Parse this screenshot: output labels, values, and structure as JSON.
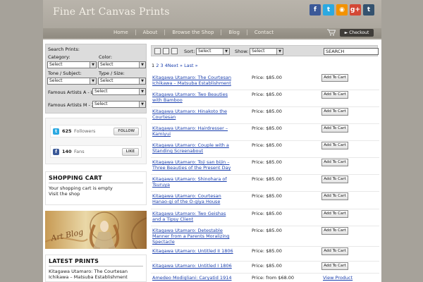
{
  "site": {
    "title": "Fine Art Canvas Prints"
  },
  "social": [
    {
      "name": "facebook-icon",
      "glyph": "f",
      "color": "#3b5998"
    },
    {
      "name": "twitter-icon",
      "glyph": "t",
      "color": "#2ba9e1"
    },
    {
      "name": "rss-icon",
      "glyph": "◉",
      "color": "#f39200"
    },
    {
      "name": "googleplus-icon",
      "glyph": "g+",
      "color": "#d34836"
    },
    {
      "name": "tumblr-icon",
      "glyph": "t",
      "color": "#34526f"
    }
  ],
  "nav": {
    "items": [
      "Home",
      "About",
      "Browse the Shop",
      "Blog",
      "Contact"
    ],
    "checkout": "► Checkout"
  },
  "search": {
    "heading": "Search Prints:",
    "category_label": "Category:",
    "color_label": "Color:",
    "tone_label": "Tone / Subject:",
    "type_label": "Type / Size:",
    "artists_al_label": "Famous Artists A - L",
    "artists_mz_label": "Famous Artists M - Z",
    "select_value": "Select"
  },
  "counts": {
    "twitter_count": "625",
    "twitter_label": "Followers",
    "twitter_btn": "FOLLOW",
    "facebook_count": "140",
    "facebook_label": "Fans",
    "facebook_btn": "LIKE"
  },
  "cart": {
    "heading": "SHOPPING CART",
    "empty_text": "Your shopping cart is empty",
    "visit_link": "Visit the shop"
  },
  "blog_banner": {
    "text": "Art Blog"
  },
  "latest": {
    "heading": "LATEST PRINTS",
    "item": "Kitagawa Utamaro: The Courtesan Ichikawa – Matsuba Establishment"
  },
  "toolbar": {
    "sort_label": "Sort:",
    "sort_value": "Select",
    "show_label": "Show:",
    "show_value": "Select",
    "search_value": "SEARCH"
  },
  "pagination": {
    "current": "1",
    "pages": [
      "2",
      "3",
      "4"
    ],
    "next": "Next »",
    "last": "Last »"
  },
  "products": [
    {
      "title": "Kitagawa Utamaro: The Courtesan Ichikawa – Matsuba Establishment",
      "price": "Price: $85.00",
      "action": "Add To Cart"
    },
    {
      "title": "Kitagawa Utamaro: Two Beauties with Bamboo",
      "price": "Price: $85.00",
      "action": "Add To Cart"
    },
    {
      "title": "Kitagawa Utamaro: Hinakoto the Courtesan",
      "price": "Price: $85.00",
      "action": "Add To Cart"
    },
    {
      "title": "Kitagawa Utamaro: Hairdresser – Kamiyui",
      "price": "Price: $85.00",
      "action": "Add To Cart"
    },
    {
      "title": "Kitagawa Utamaro: Couple with a Standing Screenabout",
      "price": "Price: $85.00",
      "action": "Add To Cart"
    },
    {
      "title": "Kitagawa Utamaro: Toji san bijin – Three Beauties of the Present Day",
      "price": "Price: $85.00",
      "action": "Add To Cart"
    },
    {
      "title": "Kitagawa Utamaro: Shinohara of Tsuruya",
      "price": "Price: $85.00",
      "action": "Add To Cart"
    },
    {
      "title": "Kitagawa Utamaro: Courtesan Hanao-gi of the O-giya House",
      "price": "Price: $85.00",
      "action": "Add To Cart"
    },
    {
      "title": "Kitagawa Utamaro: Two Geishas and a Tipsy Client",
      "price": "Price: $85.00",
      "action": "Add To Cart"
    },
    {
      "title": "Kitagawa Utamaro: Detestable Manner from a Parents Moralizing Spectacle",
      "price": "Price: $85.00",
      "action": "Add To Cart"
    },
    {
      "title": "Kitagawa Utamaro: Untitled II 1806",
      "price": "Price: $85.00",
      "action": "Add To Cart"
    },
    {
      "title": "Kitagawa Utamaro: Untitled I 1806",
      "price": "Price: $85.00",
      "action": "Add To Cart"
    },
    {
      "title": "Amedeo Modigliani: Caryatid 1914",
      "price": "Price: from $68.00",
      "action": "View Product",
      "is_link": true
    }
  ]
}
